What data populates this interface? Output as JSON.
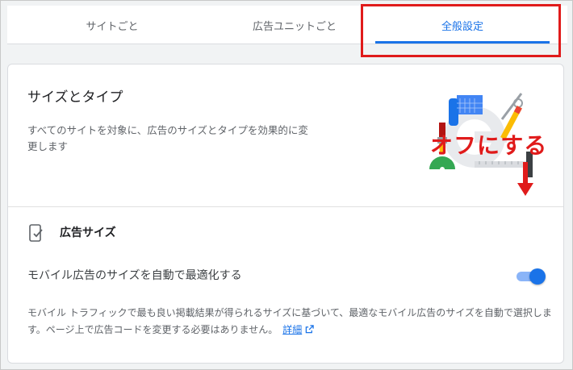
{
  "tabs": [
    {
      "label": "サイトごと"
    },
    {
      "label": "広告ユニットごと"
    },
    {
      "label": "全般設定"
    }
  ],
  "active_tab": "全般設定",
  "card": {
    "title": "サイズとタイプ",
    "description": "すべてのサイトを対象に、広告のサイズとタイプを効果的に変更します"
  },
  "section": {
    "icon": "mobile-check-icon",
    "title": "広告サイズ",
    "setting_label": "モバイル広告のサイズを自動で最適化する",
    "toggle_on": true,
    "help_text": "モバイル トラフィックで最も良い掲載結果が得られるサイズに基づいて、最適なモバイル広告のサイズを自動で選択します。ページ上で広告コードを変更する必要はありません。",
    "help_link": "詳細",
    "help_link_icon": "external-link-icon"
  },
  "annotation": {
    "text": "オフにする",
    "color": "#e01b1b"
  },
  "colors": {
    "accent": "#1a73e8",
    "highlight": "#e01b1b"
  }
}
